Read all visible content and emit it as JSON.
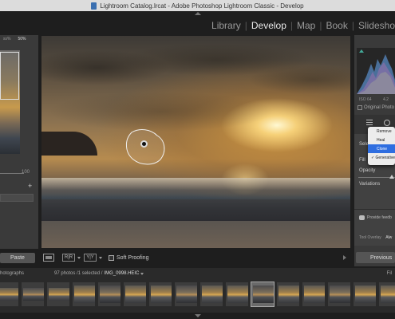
{
  "window": {
    "title": "Lightroom Catalog.lrcat - Adobe Photoshop Lightroom Classic - Develop"
  },
  "modules": [
    {
      "label": "Library",
      "active": false
    },
    {
      "label": "Develop",
      "active": true
    },
    {
      "label": "Map",
      "active": false
    },
    {
      "label": "Book",
      "active": false
    },
    {
      "label": "Slidesho",
      "active": false
    }
  ],
  "navigator": {
    "zoom_fill": "ss%",
    "zoom_fit": "50%",
    "slider_value": "100"
  },
  "left_panel": {
    "paste_label": "Paste"
  },
  "toolbar": {
    "ba_label": "R|R",
    "yy_label": "Y|Y",
    "soft_proofing_label": "Soft Proofing",
    "soft_proofing_checked": false
  },
  "histogram": {
    "iso": "ISO 64",
    "focal": "4.2",
    "original_photo_label": "Original Photo"
  },
  "tool_panel": {
    "section_label": "Sele",
    "fill_label": "Fill",
    "opacity_label": "Opacity",
    "variations_label": "Variations",
    "feedback_label": "Provide feedb",
    "tool_overlay_label": "Tool Overlay",
    "tool_overlay_value": "Alw"
  },
  "fill_menu": {
    "items": [
      {
        "label": "Remove",
        "checked": false,
        "highlighted": false
      },
      {
        "label": "Heal",
        "checked": false,
        "highlighted": false
      },
      {
        "label": "Clone",
        "checked": false,
        "highlighted": true
      },
      {
        "label": "Generative",
        "checked": true,
        "highlighted": false
      }
    ]
  },
  "right_panel": {
    "previous_label": "Previous"
  },
  "filmstrip": {
    "source_label": "hotographs",
    "count_label": "97 photos /1 selected /",
    "file_label": "IMG_0998.HEIC",
    "filter_label": "Fil",
    "thumb_count": 16,
    "selected_index": 10
  },
  "colors": {
    "menu_highlight": "#2f6ee0",
    "panel_bg": "#3a3a3a",
    "app_bg": "#1e1e1e",
    "histogram_green": "#44aa99"
  }
}
